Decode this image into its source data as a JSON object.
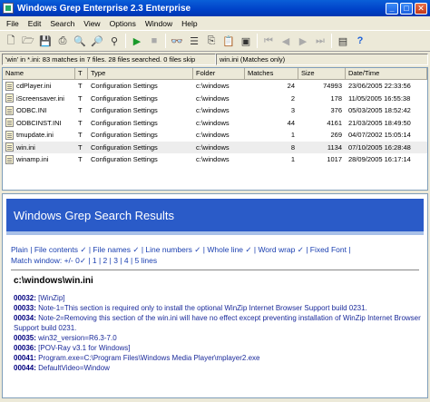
{
  "window": {
    "title": "Windows Grep Enterprise 2.3 Enterprise",
    "min": "_",
    "max": "□",
    "close": "✕"
  },
  "menu": [
    "File",
    "Edit",
    "Search",
    "View",
    "Options",
    "Window",
    "Help"
  ],
  "status": {
    "left": "'win' in *.ini: 83 matches in 7 files. 28 files searched. 0 files skip",
    "right": "win.ini (Matches only)"
  },
  "list": {
    "columns": [
      "Name",
      "T",
      "Type",
      "Folder",
      "Matches",
      "Size",
      "Date/Time"
    ],
    "rows": [
      [
        "cdPlayer.ini",
        "T",
        "Configuration Settings",
        "c:\\windows",
        "24",
        "74993",
        "23/06/2005 22:33:56"
      ],
      [
        "iScreensaver.ini",
        "T",
        "Configuration Settings",
        "c:\\windows",
        "2",
        "178",
        "11/05/2005 16:55:38"
      ],
      [
        "ODBC.INI",
        "T",
        "Configuration Settings",
        "c:\\windows",
        "3",
        "376",
        "05/03/2005 18:52:42"
      ],
      [
        "ODBCINST.INI",
        "T",
        "Configuration Settings",
        "c:\\windows",
        "44",
        "4161",
        "21/03/2005 18:49:50"
      ],
      [
        "tmupdate.ini",
        "T",
        "Configuration Settings",
        "c:\\windows",
        "1",
        "269",
        "04/07/2002 15:05:14"
      ],
      [
        "win.ini",
        "T",
        "Configuration Settings",
        "c:\\windows",
        "8",
        "1134",
        "07/10/2005 16:28:48"
      ],
      [
        "winamp.ini",
        "T",
        "Configuration Settings",
        "c:\\windows",
        "1",
        "1017",
        "28/09/2005 16:17:14"
      ]
    ],
    "selected_row": 5
  },
  "results": {
    "title": "Windows Grep Search Results",
    "options_line1": "Plain | File contents ✓ | File names ✓ | Line numbers ✓ | Whole line ✓ | Word wrap ✓ | Fixed Font |",
    "options_line2": "Match window: +/- 0✓ | 1 | 2 | 3 | 4 | 5 lines",
    "path": "c:\\windows\\win.ini",
    "lines": [
      {
        "num": "00032:",
        "text": "[WinZip]"
      },
      {
        "num": "00033:",
        "text": "Note-1=This section is required only to install the optional WinZip Internet Browser Support build 0231."
      },
      {
        "num": "00034:",
        "text": "Note-2=Removing this section of the win.ini will have no effect except preventing installation of WinZip Internet Browser Support build 0231."
      },
      {
        "num": "00035:",
        "text": "win32_version=R6.3-7.0"
      },
      {
        "num": "00036:",
        "text": "[POV-Ray v3.1 for Windows]"
      },
      {
        "num": "00041:",
        "text": "Program.exe=C:\\Program Files\\Windows Media Player\\mplayer2.exe"
      },
      {
        "num": "00044:",
        "text": "DefaultVideo=Window"
      }
    ]
  },
  "toolbar_icons": [
    "new-icon",
    "open-icon",
    "save-icon",
    "print-icon",
    "search-icon",
    "search-next-icon",
    "filter-icon",
    "run-icon",
    "stop-icon",
    "glasses-icon",
    "view-icon",
    "copy-icon",
    "paste-icon",
    "export-icon",
    "first-icon",
    "prev-icon",
    "next-icon",
    "last-icon",
    "properties-icon",
    "help-icon"
  ]
}
